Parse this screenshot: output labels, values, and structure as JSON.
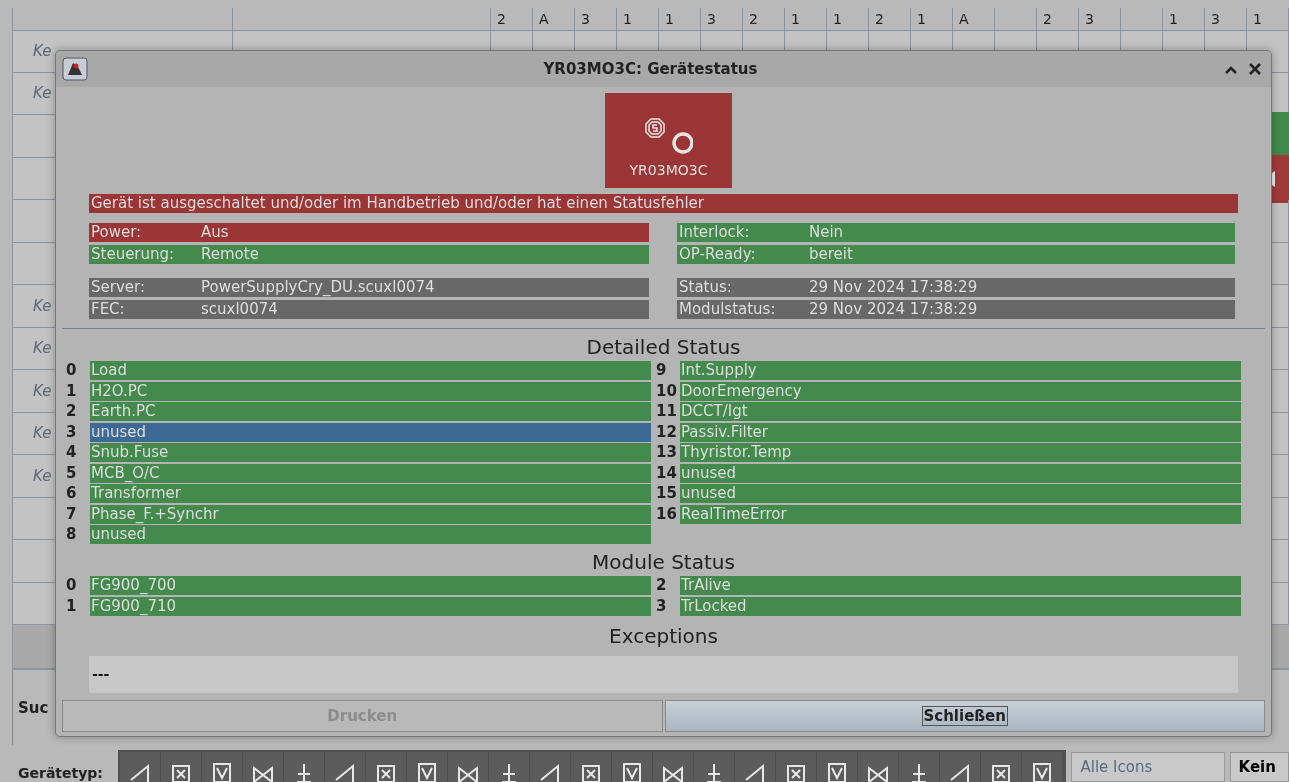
{
  "background": {
    "header_cells": [
      "2",
      "A",
      "3",
      "1",
      "1",
      "3",
      "2",
      "1",
      "1",
      "2",
      "1",
      "A",
      "",
      "2",
      "3",
      "",
      "1",
      "3",
      "1"
    ],
    "rows": [
      {
        "hint": "Ke"
      },
      {
        "hint": "Ke"
      },
      {
        "hint": "",
        "color": "#3f8a4a"
      },
      {
        "hint": "",
        "color": "#a03a3a"
      },
      {
        "hint": ""
      },
      {
        "hint": ""
      },
      {
        "hint": "Ke"
      },
      {
        "hint": "Ke"
      },
      {
        "hint": "Ke"
      },
      {
        "hint": "Ke"
      },
      {
        "hint": "Ke"
      },
      {
        "hint": ""
      },
      {
        "hint": ""
      },
      {
        "hint": ""
      }
    ],
    "search_label": "Suc",
    "type_label": "Gerätetyp:",
    "all_icons_button": "Alle Icons",
    "none_button": "Kein"
  },
  "dialog": {
    "title": "YR03MO3C: Gerätestatus",
    "device": {
      "name": "YR03MO3C",
      "color": "#9c3535"
    },
    "message": {
      "text": "Gerät ist ausgeschaltet und/oder im Handbetrieb und/oder hat einen Statusfehler",
      "color": "#9c3535"
    },
    "info_left": [
      {
        "label": "Power:",
        "value": "Aus",
        "color": "#9c3535"
      },
      {
        "label": "Steuerung:",
        "value": "Remote",
        "color": "#438a4c"
      },
      {
        "label": "Server:",
        "value": "PowerSupplyCry_DU.scuxl0074",
        "color": "#686868"
      },
      {
        "label": "FEC:",
        "value": "scuxl0074",
        "color": "#686868"
      }
    ],
    "info_right": [
      {
        "label": "Interlock:",
        "value": "Nein",
        "color": "#438a4c"
      },
      {
        "label": "OP-Ready:",
        "value": "bereit",
        "color": "#438a4c"
      },
      {
        "label": "Status:",
        "value": "29 Nov 2024 17:38:29",
        "color": "#686868"
      },
      {
        "label": "Modulstatus:",
        "value": "29 Nov 2024 17:38:29",
        "color": "#686868"
      }
    ],
    "detailed_title": "Detailed Status",
    "detailed_left": [
      {
        "index": "0",
        "name": "Load",
        "color": "#438a4c"
      },
      {
        "index": "1",
        "name": "H2O.PC",
        "color": "#438a4c"
      },
      {
        "index": "2",
        "name": "Earth.PC",
        "color": "#438a4c"
      },
      {
        "index": "3",
        "name": "unused",
        "color": "#3d6a94"
      },
      {
        "index": "4",
        "name": "Snub.Fuse",
        "color": "#438a4c"
      },
      {
        "index": "5",
        "name": "MCB_O/C",
        "color": "#438a4c"
      },
      {
        "index": "6",
        "name": "Transformer",
        "color": "#438a4c"
      },
      {
        "index": "7",
        "name": "Phase_F.+Synchr",
        "color": "#438a4c"
      },
      {
        "index": "8",
        "name": "unused",
        "color": "#438a4c"
      }
    ],
    "detailed_right": [
      {
        "index": "9",
        "name": "Int.Supply",
        "color": "#438a4c"
      },
      {
        "index": "10",
        "name": "DoorEmergency",
        "color": "#438a4c"
      },
      {
        "index": "11",
        "name": "DCCT/Igt",
        "color": "#438a4c"
      },
      {
        "index": "12",
        "name": "Passiv.Filter",
        "color": "#438a4c"
      },
      {
        "index": "13",
        "name": "Thyristor.Temp",
        "color": "#438a4c"
      },
      {
        "index": "14",
        "name": "unused",
        "color": "#438a4c"
      },
      {
        "index": "15",
        "name": "unused",
        "color": "#438a4c"
      },
      {
        "index": "16",
        "name": "RealTimeError",
        "color": "#438a4c"
      }
    ],
    "module_title": "Module Status",
    "module_left": [
      {
        "index": "0",
        "name": "FG900_700",
        "color": "#438a4c"
      },
      {
        "index": "1",
        "name": "FG900_710",
        "color": "#438a4c"
      }
    ],
    "module_right": [
      {
        "index": "2",
        "name": "TrAlive",
        "color": "#438a4c"
      },
      {
        "index": "3",
        "name": "TrLocked",
        "color": "#438a4c"
      }
    ],
    "exceptions_title": "Exceptions",
    "exceptions_text": "---",
    "buttons": [
      {
        "label": "Drucken",
        "disabled": true
      },
      {
        "label": "Schließen",
        "disabled": false
      }
    ]
  }
}
